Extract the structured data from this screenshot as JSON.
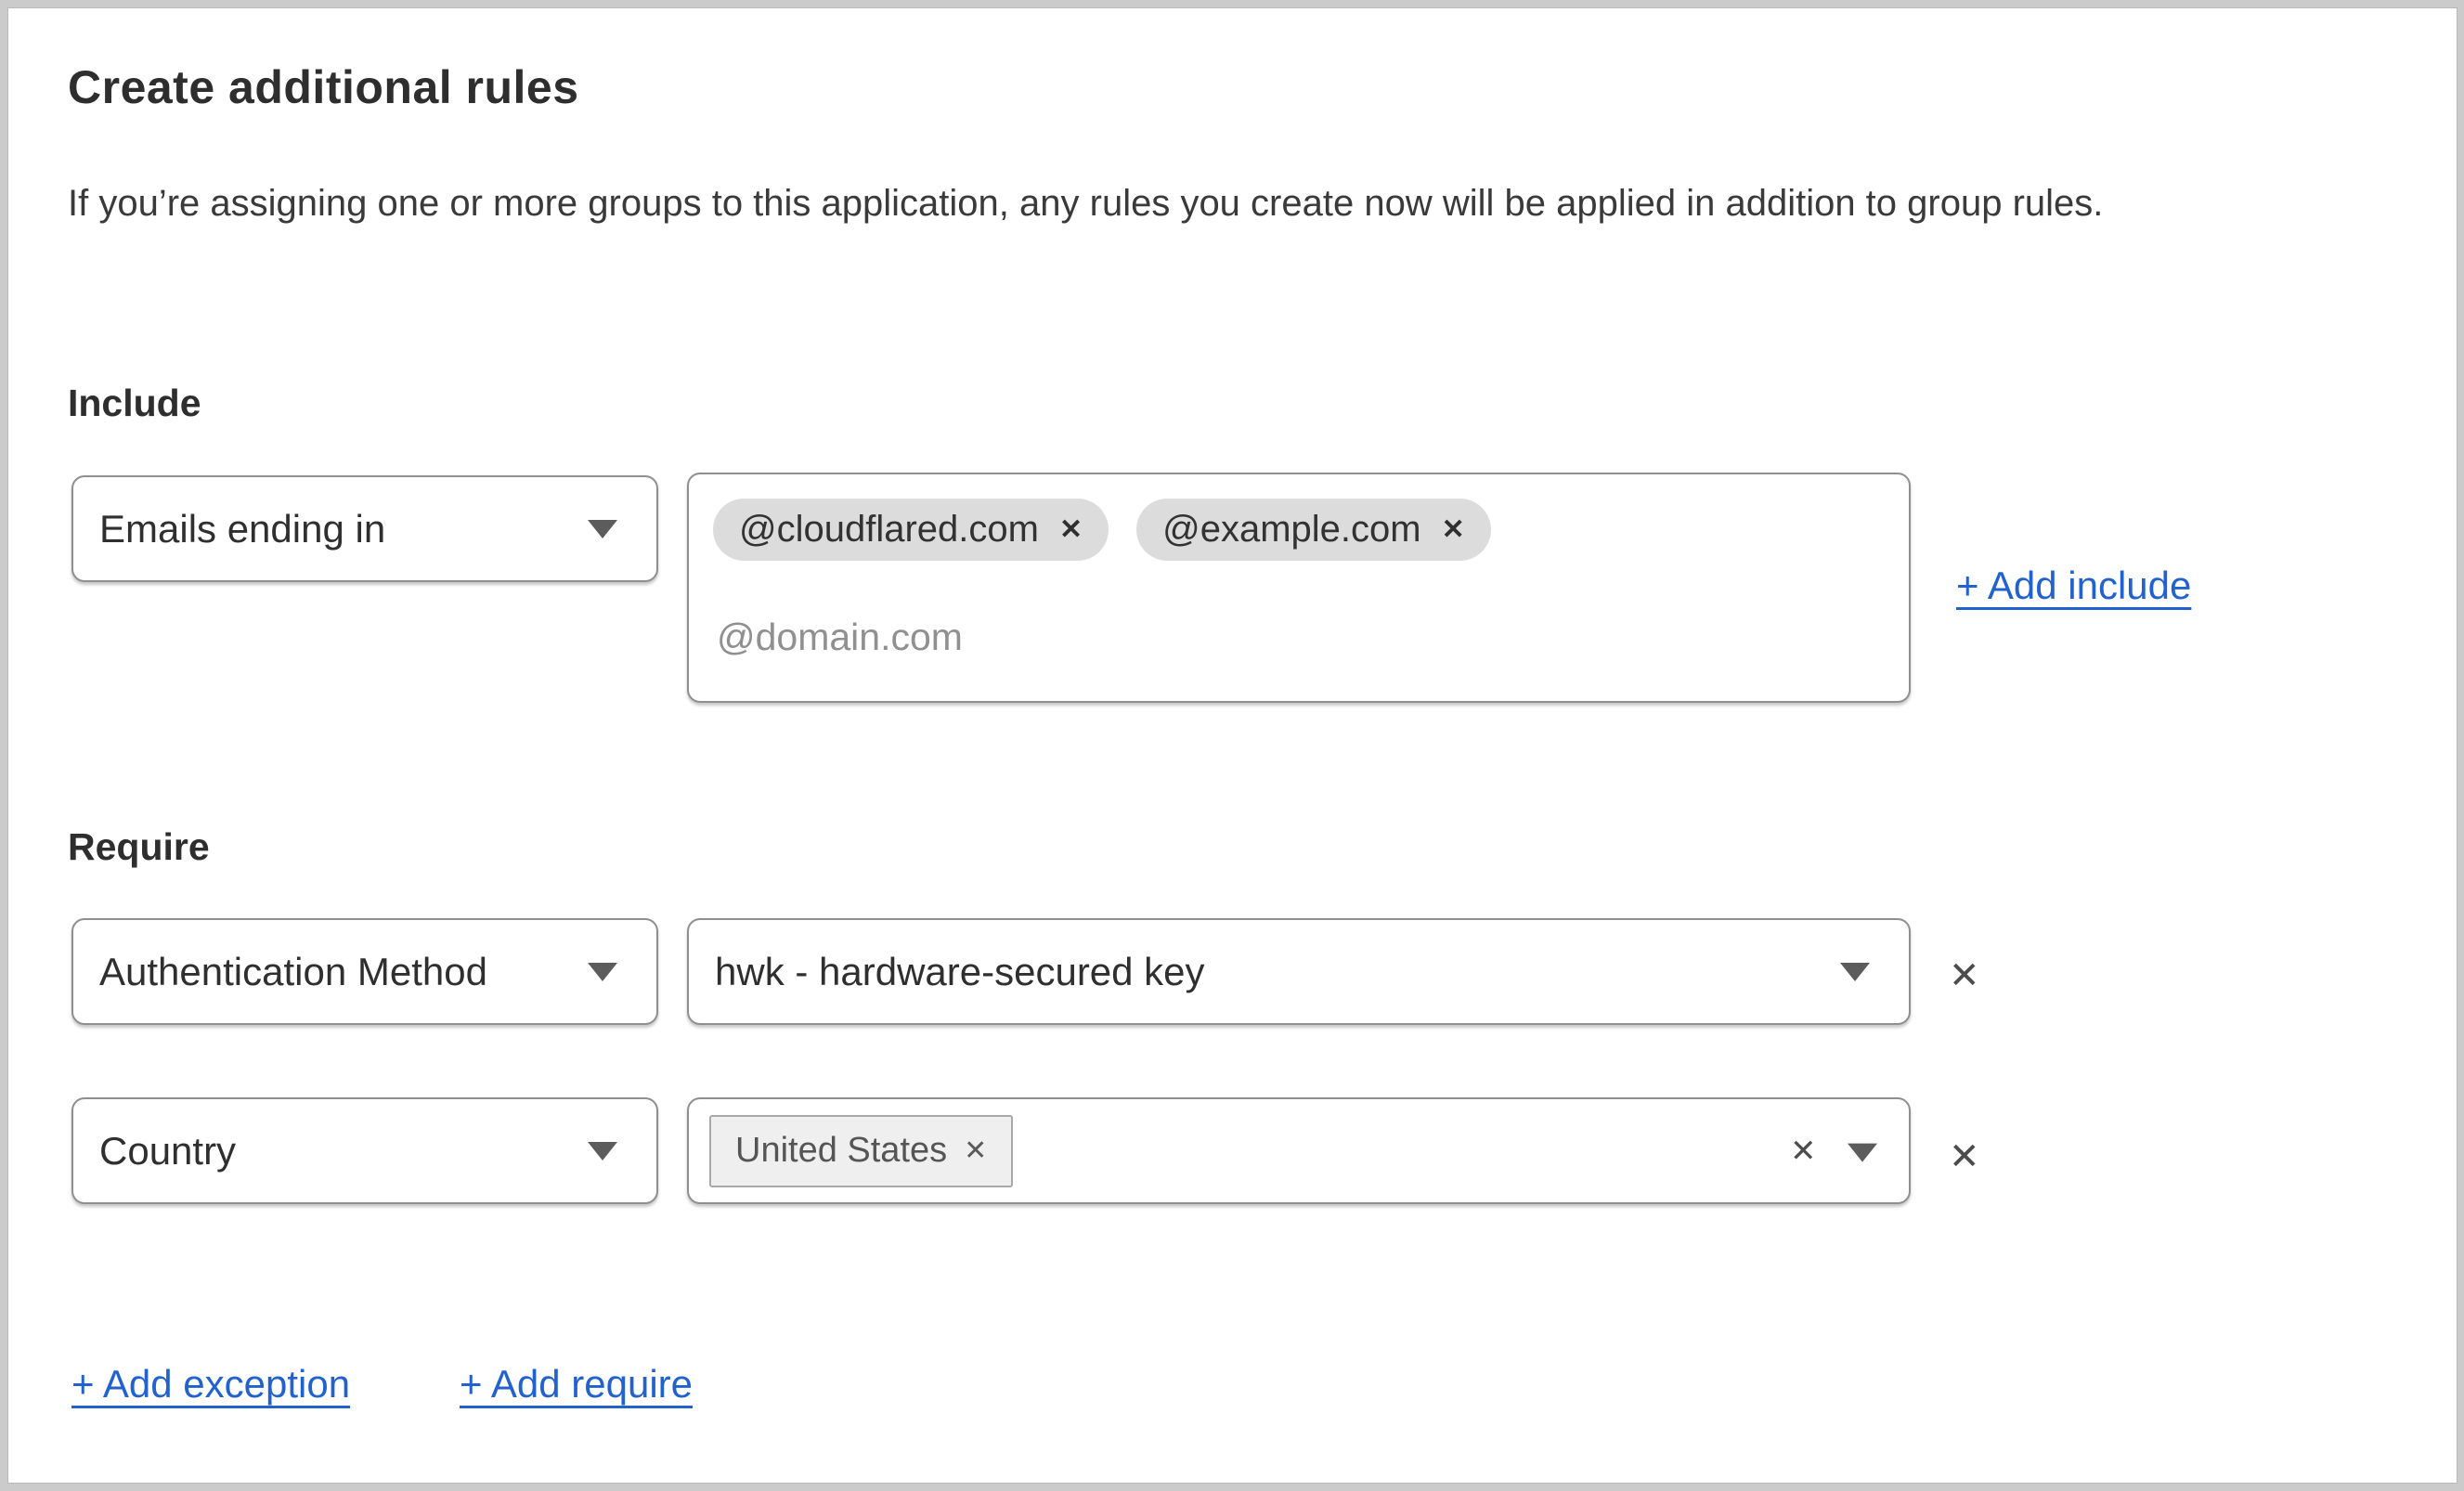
{
  "page": {
    "title": "Create additional rules",
    "description": "If you’re assigning one or more groups to this application, any rules you create now will be applied in addition to group rules."
  },
  "include": {
    "label": "Include",
    "selector_value": "Emails ending in",
    "tags": [
      {
        "text": "@cloudflared.com"
      },
      {
        "text": "@example.com"
      }
    ],
    "input_placeholder": "@domain.com",
    "add_label": "+ Add include"
  },
  "require": {
    "label": "Require",
    "rules": [
      {
        "field": "Authentication Method",
        "value": "hwk - hardware-secured key"
      },
      {
        "field": "Country",
        "tags": [
          {
            "text": "United States"
          }
        ]
      }
    ]
  },
  "footer": {
    "add_exception_label": "+ Add exception",
    "add_require_label": "+ Add require"
  },
  "icons": {
    "close": "✕",
    "chevron_down": "▼"
  },
  "colors": {
    "link_blue": "#2262cf",
    "control_border": "#8f8f8f",
    "tag_background": "#dcdcdc",
    "country_tag_background": "#efefef",
    "frame_gray": "#cbcbcb"
  }
}
